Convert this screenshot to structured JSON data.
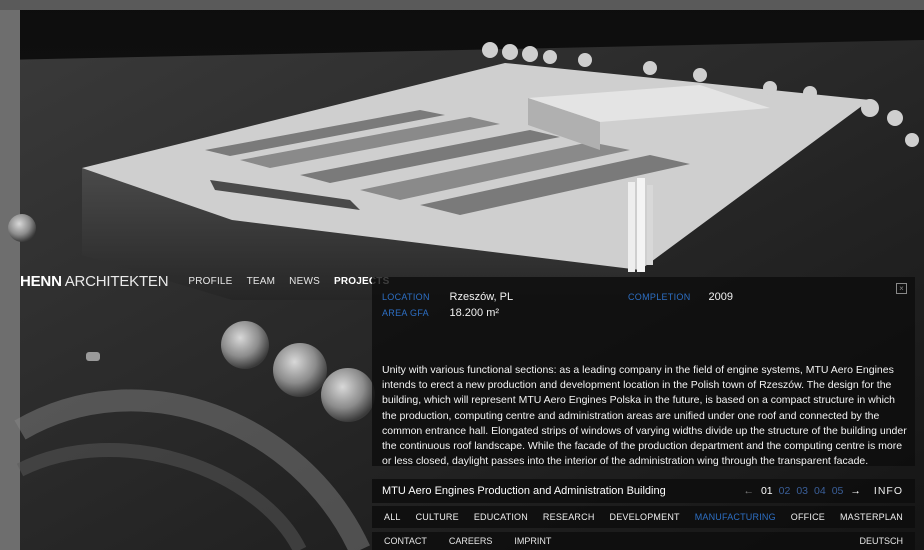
{
  "brand": {
    "bold": "HENN",
    "light": "ARCHITEKTEN"
  },
  "nav": {
    "items": [
      {
        "label": "PROFILE",
        "active": false
      },
      {
        "label": "TEAM",
        "active": false
      },
      {
        "label": "NEWS",
        "active": false
      },
      {
        "label": "PROJECTS",
        "active": true
      }
    ]
  },
  "panel": {
    "close_glyph": "×",
    "location_label": "LOCATION",
    "location": "Rzeszów, PL",
    "area_label": "AREA GFA",
    "area": "18.200 m²",
    "completion_label": "COMPLETION",
    "completion": "2009",
    "description": "Unity with various functional sections: as a leading company in the field of engine systems, MTU Aero Engines intends to erect a new production and development location in the Polish town of Rzeszów. The design for the building, which will represent MTU Aero Engines Polska in the future, is based on a compact structure in which the production, computing centre and administration areas are unified under one roof and connected by the common entrance hall. Elongated strips of windows of varying widths divide up the structure of the building under the continuous roof landscape. While the facade of the production department and the computing centre is more or less closed, daylight passes into the interior of the administration wing through the transparent facade."
  },
  "titlebar": {
    "project_title": "MTU Aero Engines Production and Administration Building",
    "prev_arrow": "←",
    "next_arrow": "→",
    "pages": [
      "01",
      "02",
      "03",
      "04",
      "05"
    ],
    "current_page": "01",
    "info_label": "INFO"
  },
  "categories": [
    {
      "label": "ALL",
      "active": false
    },
    {
      "label": "CULTURE",
      "active": false
    },
    {
      "label": "EDUCATION",
      "active": false
    },
    {
      "label": "RESEARCH",
      "active": false
    },
    {
      "label": "DEVELOPMENT",
      "active": false
    },
    {
      "label": "MANUFACTURING",
      "active": true
    },
    {
      "label": "OFFICE",
      "active": false
    },
    {
      "label": "MASTERPLAN",
      "active": false
    }
  ],
  "footer": {
    "links": [
      "CONTACT",
      "CAREERS",
      "IMPRINT"
    ],
    "language": "DEUTSCH"
  },
  "colors": {
    "accent_blue": "#2d6fc4",
    "panel_bg": "rgba(12,12,12,0.80)"
  }
}
